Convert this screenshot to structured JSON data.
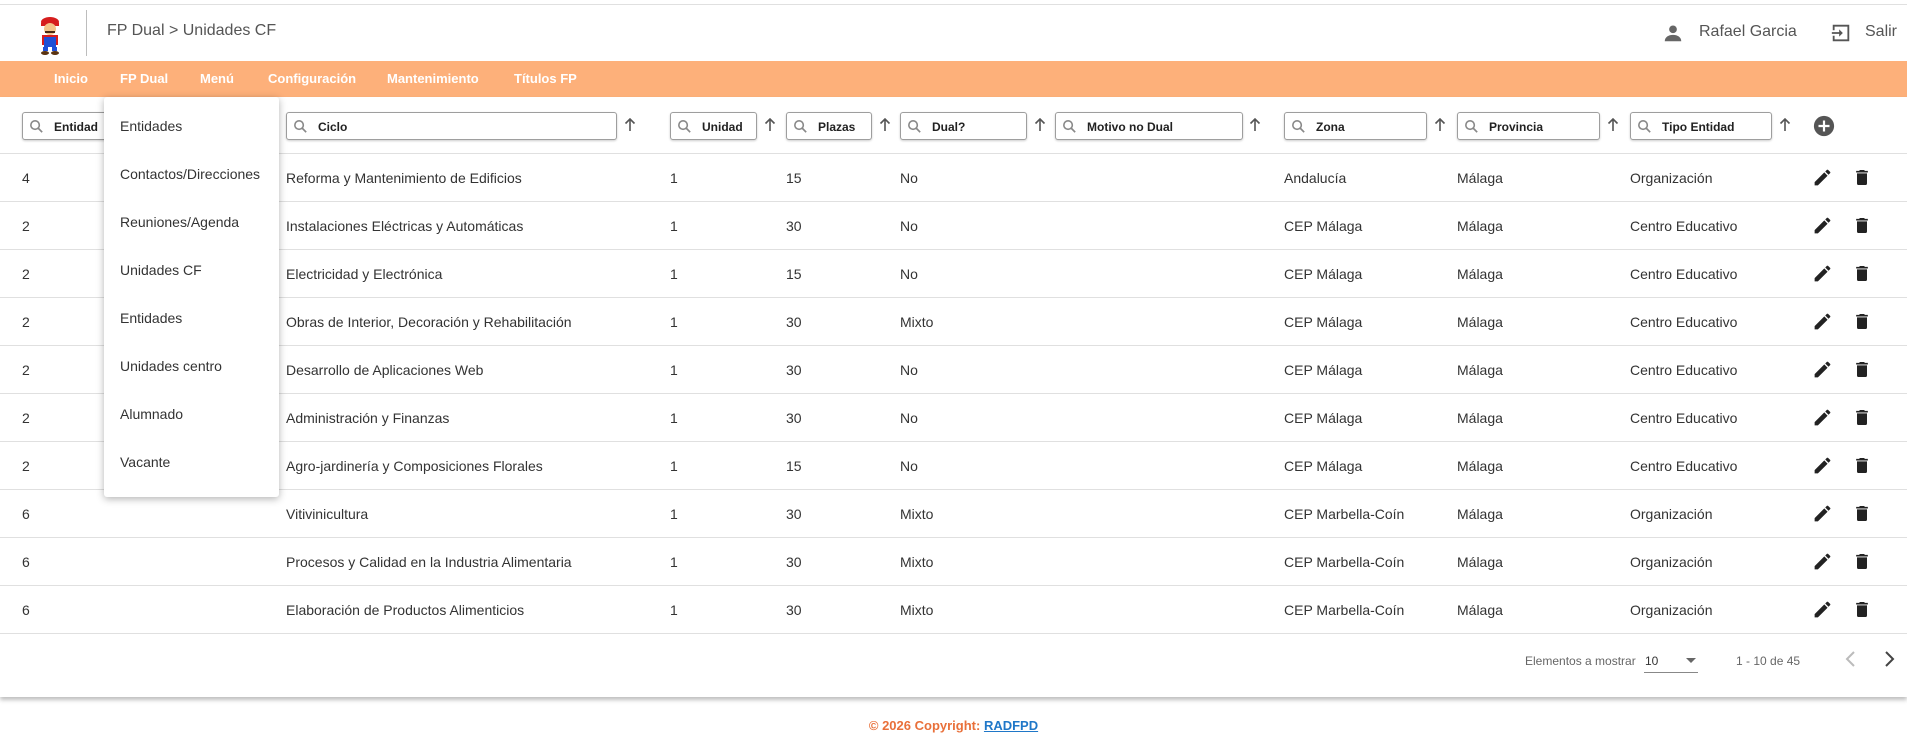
{
  "header": {
    "breadcrumb": "FP Dual > Unidades CF",
    "user_name": "Rafael Garcia",
    "logout_label": "Salir"
  },
  "nav": {
    "items": [
      "Inicio",
      "FP Dual",
      "Menú",
      "Configuración",
      "Mantenimiento",
      "Títulos FP"
    ]
  },
  "dropdown": {
    "items": [
      "Entidades",
      "Contactos/Direcciones",
      "Reuniones/Agenda",
      "Unidades CF",
      "Entidades",
      "Unidades centro",
      "Alumnado",
      "Vacante"
    ]
  },
  "filters": {
    "entidad": "Entidad",
    "ciclo": "Ciclo",
    "unidad": "Unidad",
    "plazas": "Plazas",
    "dual": "Dual?",
    "motivo": "Motivo no Dual",
    "zona": "Zona",
    "provincia": "Provincia",
    "tipo": "Tipo Entidad"
  },
  "rows": [
    {
      "entidad": "4",
      "ciclo": "Reforma y Mantenimiento de Edificios",
      "unidad": "1",
      "plazas": "15",
      "dual": "No",
      "zona": "Andalucía",
      "provincia": "Málaga",
      "tipo": "Organización"
    },
    {
      "entidad": "2",
      "ciclo": "Instalaciones Eléctricas y Automáticas",
      "unidad": "1",
      "plazas": "30",
      "dual": "No",
      "zona": "CEP Málaga",
      "provincia": "Málaga",
      "tipo": "Centro Educativo"
    },
    {
      "entidad": "2",
      "ciclo": "Electricidad y Electrónica",
      "unidad": "1",
      "plazas": "15",
      "dual": "No",
      "zona": "CEP Málaga",
      "provincia": "Málaga",
      "tipo": "Centro Educativo"
    },
    {
      "entidad": "2",
      "ciclo": "Obras de Interior, Decoración y Rehabilitación",
      "unidad": "1",
      "plazas": "30",
      "dual": "Mixto",
      "zona": "CEP Málaga",
      "provincia": "Málaga",
      "tipo": "Centro Educativo"
    },
    {
      "entidad": "2",
      "ciclo": "Desarrollo de Aplicaciones Web",
      "unidad": "1",
      "plazas": "30",
      "dual": "No",
      "zona": "CEP Málaga",
      "provincia": "Málaga",
      "tipo": "Centro Educativo"
    },
    {
      "entidad": "2",
      "ciclo": "Administración y Finanzas",
      "unidad": "1",
      "plazas": "30",
      "dual": "No",
      "zona": "CEP Málaga",
      "provincia": "Málaga",
      "tipo": "Centro Educativo"
    },
    {
      "entidad": "2",
      "ciclo": "Agro-jardinería y Composiciones Florales",
      "unidad": "1",
      "plazas": "15",
      "dual": "No",
      "zona": "CEP Málaga",
      "provincia": "Málaga",
      "tipo": "Centro Educativo"
    },
    {
      "entidad": "6",
      "ciclo": "Vitivinicultura",
      "unidad": "1",
      "plazas": "30",
      "dual": "Mixto",
      "zona": "CEP Marbella-Coín",
      "provincia": "Málaga",
      "tipo": "Organización"
    },
    {
      "entidad": "6",
      "ciclo": "Procesos y Calidad en la Industria Alimentaria",
      "unidad": "1",
      "plazas": "30",
      "dual": "Mixto",
      "zona": "CEP Marbella-Coín",
      "provincia": "Málaga",
      "tipo": "Organización"
    },
    {
      "entidad": "6",
      "ciclo": "Elaboración de Productos Alimenticios",
      "unidad": "1",
      "plazas": "30",
      "dual": "Mixto",
      "zona": "CEP Marbella-Coín",
      "provincia": "Málaga",
      "tipo": "Organización"
    }
  ],
  "pager": {
    "label": "Elementos a mostrar",
    "page_size": "10",
    "range": "1 - 10 de 45"
  },
  "footer": {
    "text": "© 2026 Copyright: ",
    "link": "RADFPD"
  },
  "colors": {
    "navbar": "#fdb07a",
    "footer_text": "#e9703a",
    "footer_link": "#1f77c8"
  },
  "icons": [
    "mario-logo-icon",
    "user-icon",
    "exit-icon",
    "search-icon",
    "arrow-up-icon",
    "add-circle-icon",
    "pencil-icon",
    "trash-icon",
    "chevron-left-icon",
    "chevron-right-icon"
  ]
}
